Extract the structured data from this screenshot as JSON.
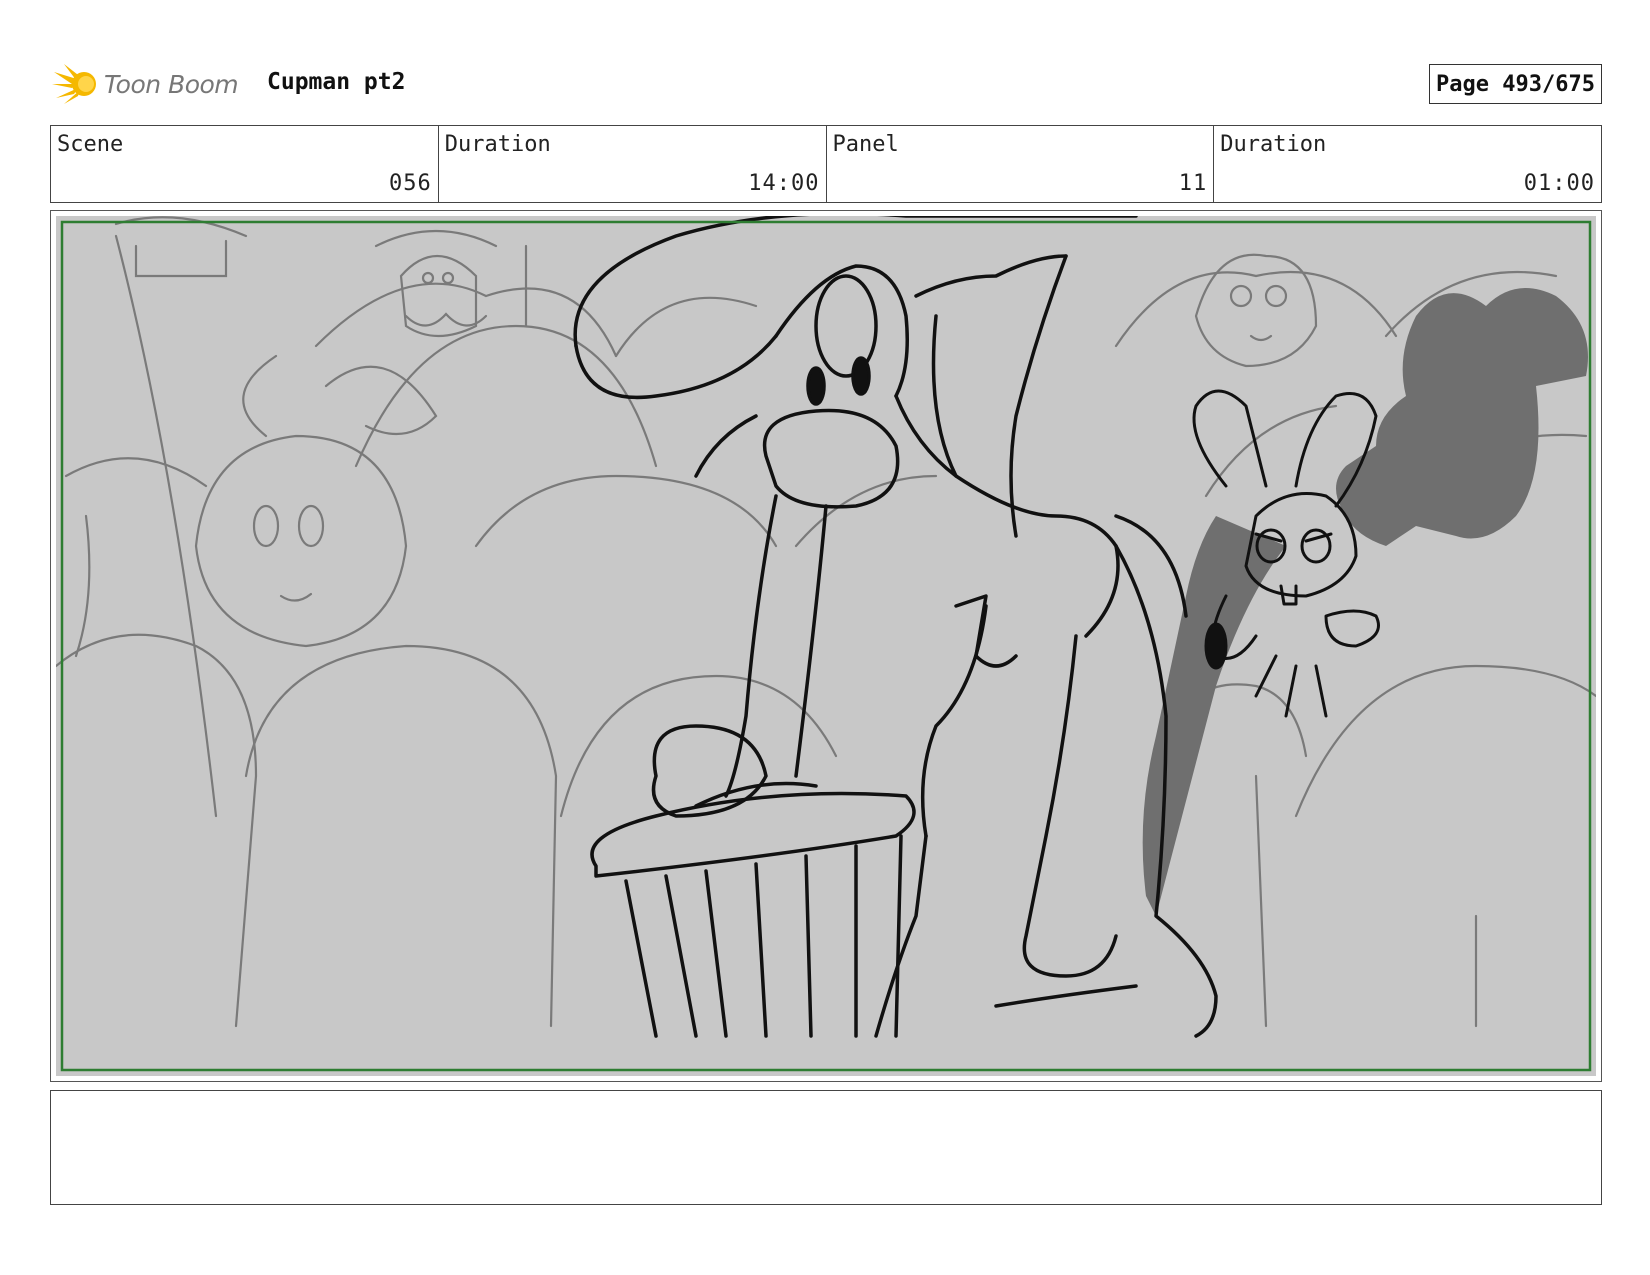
{
  "header": {
    "logo_text": "Toon Boom",
    "title": "Cupman pt2",
    "page_label": "Page 493/675"
  },
  "info": [
    {
      "label": "Scene",
      "value": "056"
    },
    {
      "label": "Duration",
      "value": "14:00"
    },
    {
      "label": "Panel",
      "value": "11"
    },
    {
      "label": "Duration",
      "value": "01:00"
    }
  ],
  "panel": {
    "background_color": "#c8c8c8",
    "safe_frame_color": "#2e7d32",
    "line_color": "#111111",
    "sketch_color": "#7a7a7a",
    "shadow_color": "#6f6f6f"
  },
  "notes": {
    "text": ""
  },
  "logo_colors": {
    "burst": "#f5b800",
    "word": "#777777"
  }
}
